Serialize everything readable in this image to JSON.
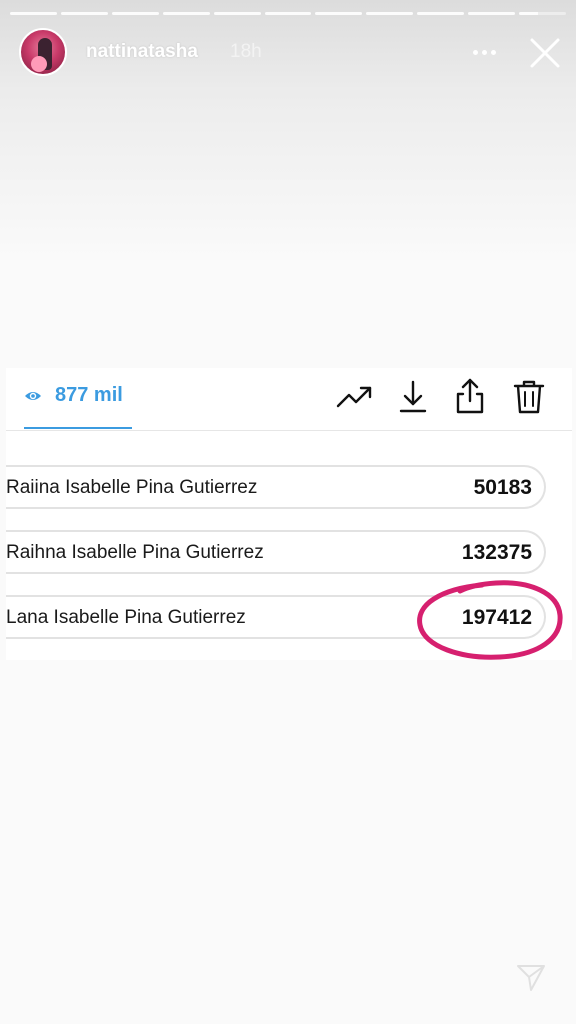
{
  "story": {
    "username": "nattinatasha",
    "time": "18h",
    "progress_segments": 11,
    "current_segment_progress": 0.4
  },
  "screenshot": {
    "views": "877 mil",
    "rows": [
      {
        "name": "Raiina Isabelle Pina Gutierrez",
        "value": "50183"
      },
      {
        "name": "Raihna Isabelle Pina Gutierrez",
        "value": "132375"
      },
      {
        "name": "Lana Isabelle Pina Gutierrez",
        "value": "197412"
      }
    ]
  },
  "icons": {
    "more": "more-dots-icon",
    "close": "close-icon",
    "eye": "eye-icon",
    "trend": "trending-up-icon",
    "download": "download-icon",
    "share": "share-icon",
    "delete": "trash-icon",
    "send": "send-icon"
  },
  "colors": {
    "accent_blue": "#3b9be0",
    "highlight_pink": "#d6206f"
  }
}
